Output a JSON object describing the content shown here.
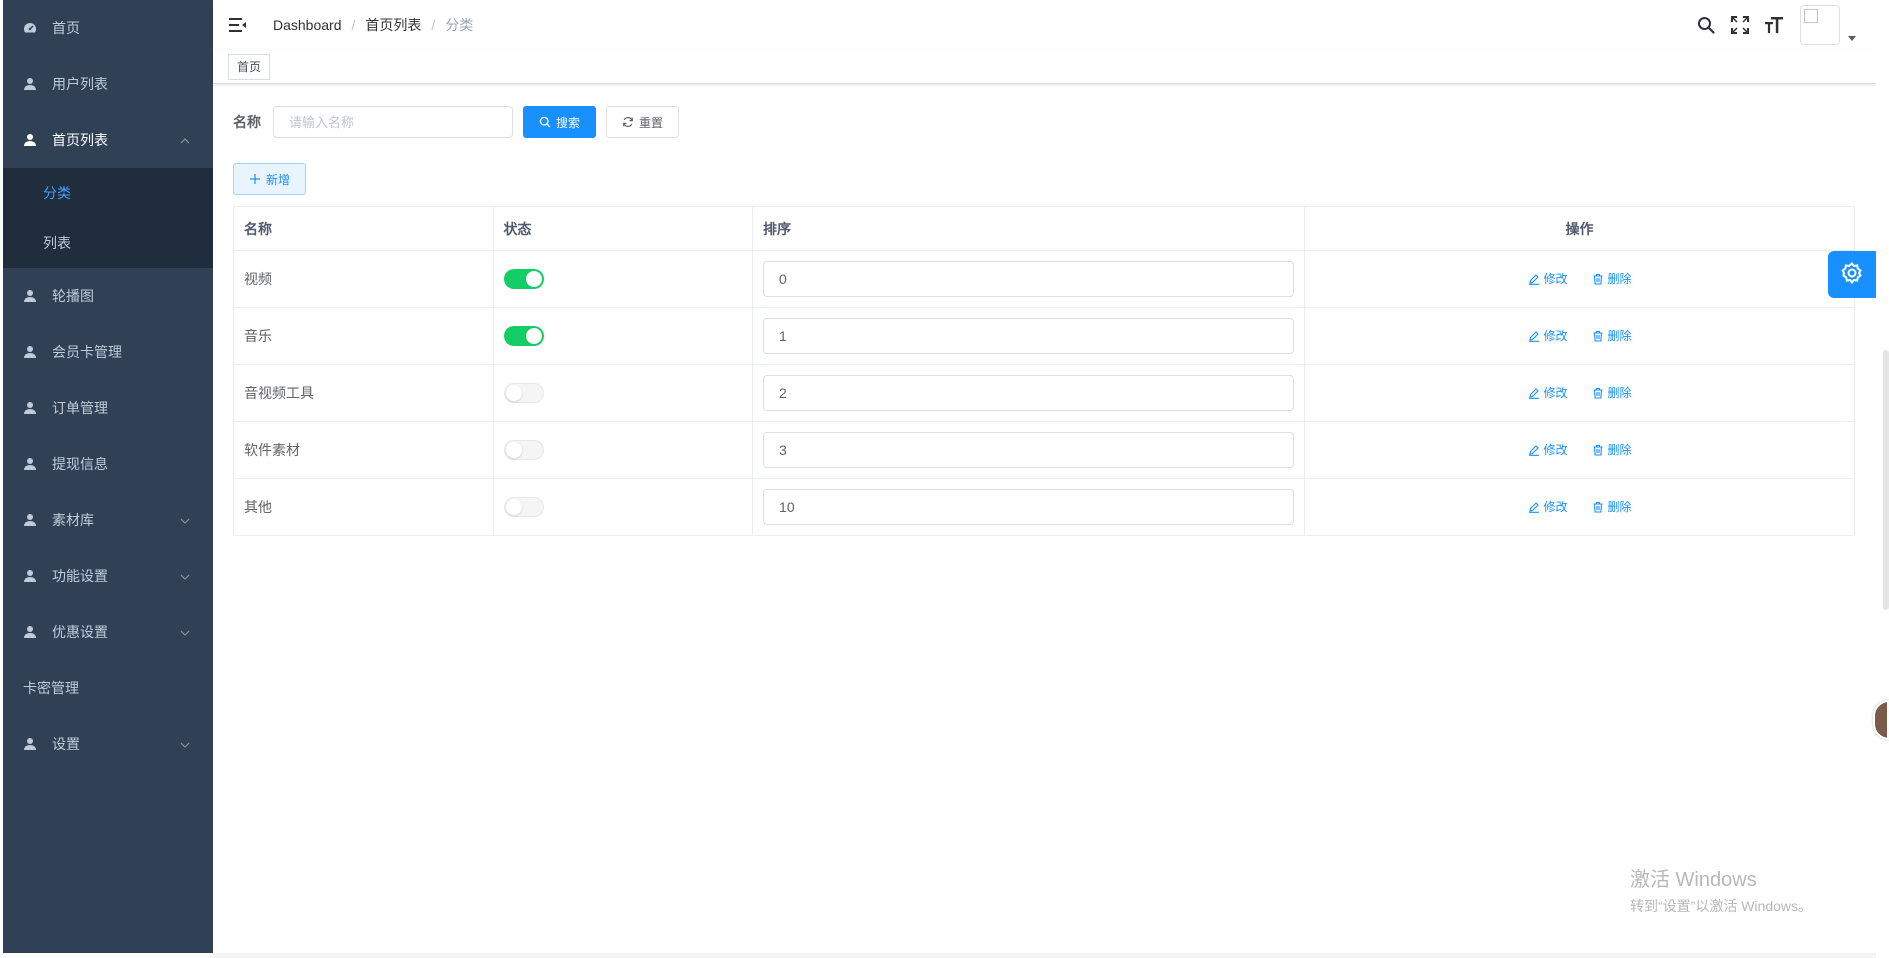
{
  "sidebar": {
    "items": [
      {
        "label": "首页",
        "icon": "dashboard-icon"
      },
      {
        "label": "用户列表",
        "icon": "user-icon"
      },
      {
        "label": "首页列表",
        "icon": "user-icon",
        "expanded": true,
        "children": [
          {
            "label": "分类",
            "active": true
          },
          {
            "label": "列表",
            "active": false
          }
        ]
      },
      {
        "label": "轮播图",
        "icon": "user-icon"
      },
      {
        "label": "会员卡管理",
        "icon": "user-icon"
      },
      {
        "label": "订单管理",
        "icon": "user-icon"
      },
      {
        "label": "提现信息",
        "icon": "user-icon"
      },
      {
        "label": "素材库",
        "icon": "user-icon",
        "has_submenu": true
      },
      {
        "label": "功能设置",
        "icon": "user-icon",
        "has_submenu": true
      },
      {
        "label": "优惠设置",
        "icon": "user-icon",
        "has_submenu": true
      },
      {
        "label": "卡密管理"
      },
      {
        "label": "设置",
        "icon": "user-icon",
        "has_submenu": true
      }
    ]
  },
  "navbar": {
    "breadcrumb": [
      "Dashboard",
      "首页列表",
      "分类"
    ],
    "separator": "/",
    "icons": [
      "search-icon",
      "fullscreen-icon",
      "font-size-icon"
    ]
  },
  "tags": {
    "items": [
      "首页"
    ]
  },
  "search": {
    "label": "名称",
    "placeholder": "请输入名称",
    "search_button": "搜索",
    "reset_button": "重置"
  },
  "toolbar": {
    "add_button": "新增"
  },
  "table": {
    "headers": {
      "name": "名称",
      "status": "状态",
      "sort": "排序",
      "ops": "操作"
    },
    "rows": [
      {
        "name": "视频",
        "status": true,
        "sort": "0"
      },
      {
        "name": "音乐",
        "status": true,
        "sort": "1"
      },
      {
        "name": "音视频工具",
        "status": false,
        "sort": "2"
      },
      {
        "name": "软件素材",
        "status": false,
        "sort": "3"
      },
      {
        "name": "其他",
        "status": false,
        "sort": "10"
      }
    ],
    "edit_label": "修改",
    "delete_label": "删除"
  },
  "watermark": {
    "line1": "激活 Windows",
    "line2": "转到“设置”以激活 Windows。"
  },
  "colors": {
    "sidebar_bg": "#304156",
    "submenu_bg": "#1f2d3d",
    "primary": "#1890ff",
    "switch_on": "#13ce66",
    "active_submenu": "#409eff"
  }
}
